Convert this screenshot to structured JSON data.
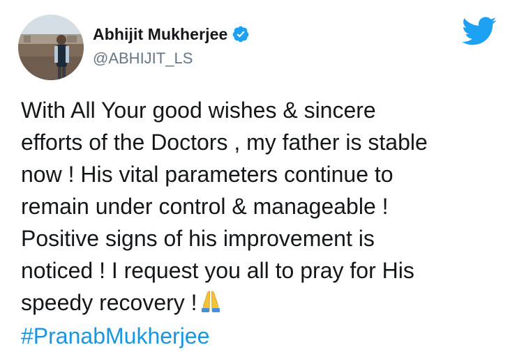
{
  "tweet": {
    "author_name": "Abhijit Mukherjee",
    "handle": "@ABHIJIT_LS",
    "verified": true,
    "text": "With All Your good wishes & sincere\nefforts of the Doctors , my father is stable\nnow ! His vital parameters continue to\nremain under control & manageable !\nPositive signs of his improvement is\nnoticed ! I request you all to pray for His\nspeedy recovery !",
    "emoji": "folded-hands",
    "hashtag": "#PranabMukherjee"
  },
  "icons": {
    "logo": "twitter-bird-icon",
    "verified": "verified-badge-icon"
  },
  "colors": {
    "brand": "#1da1f2",
    "hashtag": "#1b95e0",
    "text": "#14171a",
    "handle": "#657786"
  }
}
